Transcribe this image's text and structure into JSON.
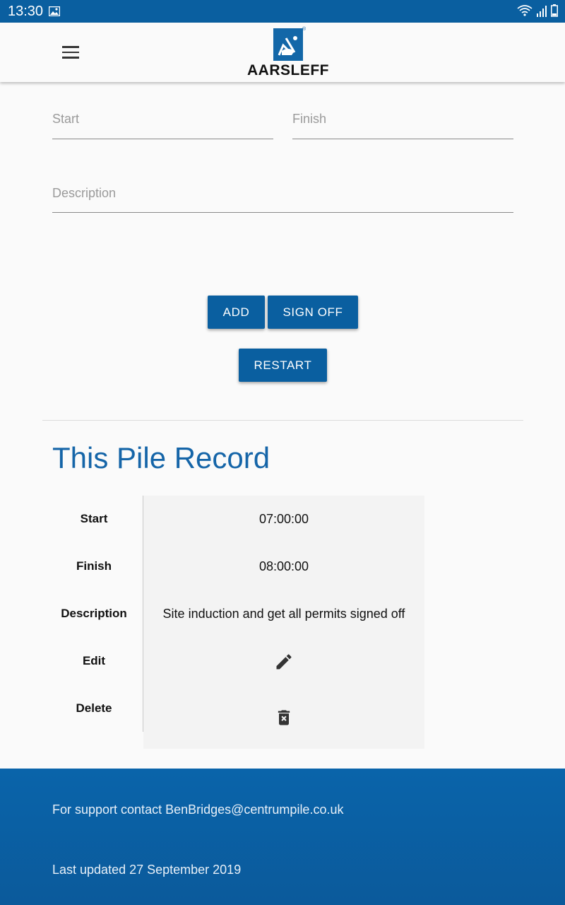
{
  "status_bar": {
    "time": "13:30",
    "icons": [
      "gallery-icon",
      "wifi-icon",
      "signal-icon",
      "battery-icon"
    ]
  },
  "app_bar": {
    "logo_text": "AARSLEFF",
    "logo_reg": "®",
    "menu_icon": "menu-icon"
  },
  "form": {
    "start_placeholder": "Start",
    "finish_placeholder": "Finish",
    "description_placeholder": "Description",
    "add_label": "ADD",
    "sign_off_label": "SIGN OFF",
    "restart_label": "RESTART"
  },
  "record": {
    "title": "This Pile Record",
    "labels": {
      "start": "Start",
      "finish": "Finish",
      "description": "Description",
      "edit": "Edit",
      "delete": "Delete"
    },
    "values": {
      "start": "07:00:00",
      "finish": "08:00:00",
      "description": "Site induction and get all permits signed off"
    },
    "edit_icon": "pencil-icon",
    "delete_icon": "trash-icon"
  },
  "footer": {
    "support": "For support contact BenBridges@centrumpile.co.uk",
    "updated": "Last updated 27 September 2019"
  },
  "colors": {
    "primary": "#0a5fa0",
    "title": "#1565a8",
    "background": "#fafafa"
  }
}
